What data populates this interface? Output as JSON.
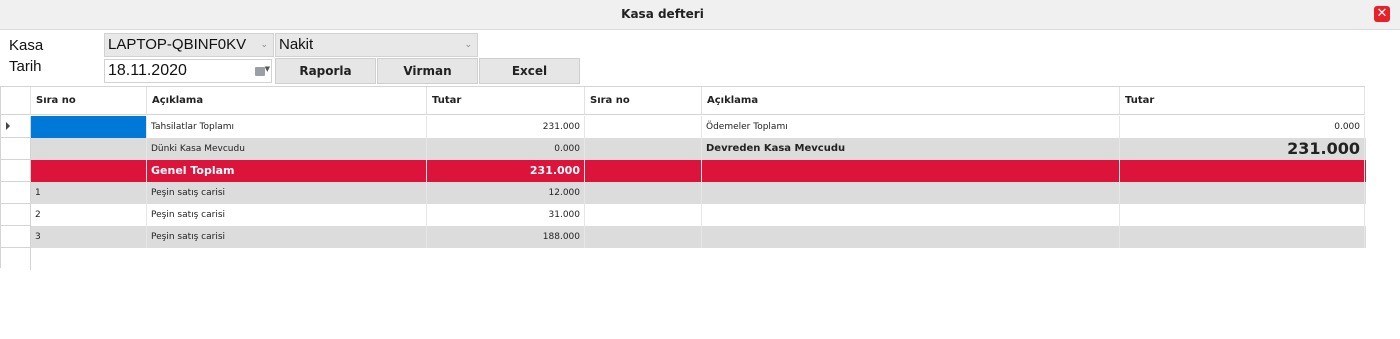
{
  "window": {
    "title": "Kasa defteri"
  },
  "form": {
    "kasa_label": "Kasa",
    "tarih_label": "Tarih",
    "kasa_value": "LAPTOP-QBINF0KV",
    "tip_value": "Nakit",
    "date_value": "18.11.2020",
    "buttons": {
      "raporla": "Raporla",
      "virman": "Virman",
      "excel": "Excel"
    }
  },
  "grid": {
    "headers": [
      "Sıra no",
      "Açıklama",
      "Tutar",
      "Sıra no",
      "Açıklama",
      "Tutar"
    ],
    "rows": [
      {
        "l_sira": "",
        "l_aciklama": "Tahsilatlar Toplamı",
        "l_tutar": "231.000",
        "r_sira": "",
        "r_aciklama": "Ödemeler Toplamı",
        "r_tutar": "0.000"
      },
      {
        "l_sira": "",
        "l_aciklama": "Dünki Kasa Mevcudu",
        "l_tutar": "0.000",
        "r_sira": "",
        "r_aciklama": "Devreden Kasa Mevcudu",
        "r_tutar": "231.000"
      },
      {
        "l_sira": "",
        "l_aciklama": "Genel Toplam",
        "l_tutar": "231.000",
        "r_sira": "",
        "r_aciklama": "",
        "r_tutar": ""
      },
      {
        "l_sira": "1",
        "l_aciklama": "Peşin satış carisi",
        "l_tutar": "12.000",
        "r_sira": "",
        "r_aciklama": "",
        "r_tutar": ""
      },
      {
        "l_sira": "2",
        "l_aciklama": "Peşin satış carisi",
        "l_tutar": "31.000",
        "r_sira": "",
        "r_aciklama": "",
        "r_tutar": ""
      },
      {
        "l_sira": "3",
        "l_aciklama": "Peşin satış carisi",
        "l_tutar": "188.000",
        "r_sira": "",
        "r_aciklama": "",
        "r_tutar": ""
      }
    ]
  },
  "colors": {
    "total_row": "#dc143c",
    "selected_cell": "#0078d7",
    "alt_row": "#dcdcdc",
    "close_button": "#e8202a"
  }
}
